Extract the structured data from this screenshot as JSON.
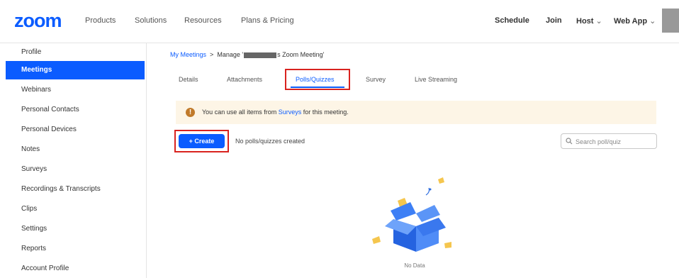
{
  "header": {
    "logo": "zoom",
    "nav_left": [
      "Products",
      "Solutions",
      "Resources",
      "Plans & Pricing"
    ],
    "nav_right": [
      "Schedule",
      "Join",
      "Host",
      "Web App"
    ]
  },
  "sidebar": {
    "items": [
      {
        "label": "Profile"
      },
      {
        "label": "Meetings",
        "active": true
      },
      {
        "label": "Webinars"
      },
      {
        "label": "Personal Contacts"
      },
      {
        "label": "Personal Devices"
      },
      {
        "label": "Notes"
      },
      {
        "label": "Surveys"
      },
      {
        "label": "Recordings & Transcripts"
      },
      {
        "label": "Clips"
      },
      {
        "label": "Settings"
      },
      {
        "label": "Reports"
      },
      {
        "label": "Account Profile"
      }
    ]
  },
  "breadcrumb": {
    "link": "My Meetings",
    "separator": ">",
    "current_prefix": "Manage '",
    "current_suffix": "s Zoom Meeting'"
  },
  "tabs": [
    {
      "label": "Details"
    },
    {
      "label": "Attachments"
    },
    {
      "label": "Polls/Quizzes",
      "active": true
    },
    {
      "label": "Survey"
    },
    {
      "label": "Live Streaming"
    }
  ],
  "notice": {
    "icon": "!",
    "text_before": "You can use all items from ",
    "link": "Surveys",
    "text_after": " for this meeting."
  },
  "create_button": "+ Create",
  "empty_message": "No polls/quizzes created",
  "search": {
    "placeholder": "Search poll/quiz"
  },
  "no_data": "No Data",
  "colors": {
    "brand": "#0b5cff",
    "highlight": "#d9231f",
    "notice_bg": "#fdf5e6"
  }
}
